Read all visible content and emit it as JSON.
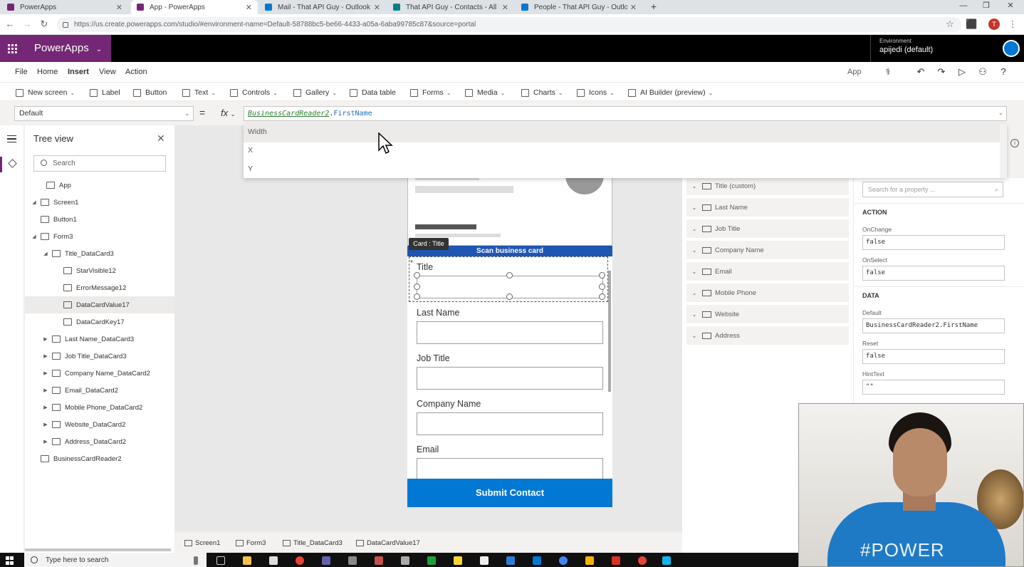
{
  "browser": {
    "tabs": [
      {
        "label": "PowerApps",
        "color": "#742774",
        "active": false
      },
      {
        "label": "App - PowerApps",
        "color": "#742774",
        "active": true
      },
      {
        "label": "Mail - That API Guy - Outlook",
        "color": "#0078d4",
        "active": false
      },
      {
        "label": "That API Guy - Contacts - All Iten",
        "color": "#038387",
        "active": false
      },
      {
        "label": "People - That API Guy - Outlook",
        "color": "#0078d4",
        "active": false
      }
    ],
    "url": "https://us.create.powerapps.com/studio/#environment-name=Default-58788bc5-be66-4433-a05a-6aba99785c87&source=portal",
    "profile_initial": "T"
  },
  "header": {
    "brand": "PowerApps",
    "env_label": "Environment",
    "env_value": "apijedi (default)"
  },
  "menu": {
    "items": [
      "File",
      "Home",
      "Insert",
      "View",
      "Action"
    ],
    "active": "Insert",
    "app_label": "App"
  },
  "ribbon": {
    "new_screen": "New screen",
    "label": "Label",
    "button": "Button",
    "text": "Text",
    "controls": "Controls",
    "gallery": "Gallery",
    "data_table": "Data table",
    "forms": "Forms",
    "media": "Media",
    "charts": "Charts",
    "icons": "Icons",
    "ai_builder": "AI Builder (preview)"
  },
  "formula": {
    "property": "Default",
    "eq": "=",
    "fx": "fx",
    "expr_part1": "BusinessCardReader2",
    "expr_dot": ".",
    "expr_part2": "FirstName",
    "suggestions": [
      "Width",
      "X",
      "Y"
    ]
  },
  "tree": {
    "title": "Tree view",
    "search_placeholder": "Search",
    "nodes": [
      {
        "label": "App",
        "indent": 0,
        "caret": ""
      },
      {
        "label": "Screen1",
        "indent": 0,
        "caret": "◢"
      },
      {
        "label": "Button1",
        "indent": 1,
        "caret": ""
      },
      {
        "label": "Form3",
        "indent": 1,
        "caret": "◢"
      },
      {
        "label": "Title_DataCard3",
        "indent": 2,
        "caret": "◢"
      },
      {
        "label": "StarVisible12",
        "indent": 3,
        "caret": ""
      },
      {
        "label": "ErrorMessage12",
        "indent": 3,
        "caret": ""
      },
      {
        "label": "DataCardValue17",
        "indent": 3,
        "caret": "",
        "selected": true
      },
      {
        "label": "DataCardKey17",
        "indent": 3,
        "caret": ""
      },
      {
        "label": "Last Name_DataCard3",
        "indent": 2,
        "caret": "▶"
      },
      {
        "label": "Job Title_DataCard3",
        "indent": 2,
        "caret": "▶"
      },
      {
        "label": "Company Name_DataCard2",
        "indent": 2,
        "caret": "▶"
      },
      {
        "label": "Email_DataCard2",
        "indent": 2,
        "caret": "▶"
      },
      {
        "label": "Mobile Phone_DataCard2",
        "indent": 2,
        "caret": "▶"
      },
      {
        "label": "Website_DataCard2",
        "indent": 2,
        "caret": "▶"
      },
      {
        "label": "Address_DataCard2",
        "indent": 2,
        "caret": "▶"
      },
      {
        "label": "BusinessCardReader2",
        "indent": 1,
        "caret": ""
      }
    ]
  },
  "canvas": {
    "card_tag": "Card : Title",
    "scan_label": "Scan business card",
    "form_labels": [
      "Title",
      "Last Name",
      "Job Title",
      "Company Name",
      "Email"
    ],
    "required_mark": "*",
    "submit_label": "Submit Contact"
  },
  "fields": [
    "Title (custom)",
    "Last Name",
    "Job Title",
    "Company Name",
    "Email",
    "Mobile Phone",
    "Website",
    "Address"
  ],
  "properties": {
    "search_placeholder": "Search for a property ...",
    "action_header": "ACTION",
    "onchange_label": "OnChange",
    "onchange_value": "false",
    "onselect_label": "OnSelect",
    "onselect_value": "false",
    "data_header": "DATA",
    "default_label": "Default",
    "default_value": "BusinessCardReader2.FirstName",
    "reset_label": "Reset",
    "reset_value": "false",
    "hinttext_label": "HintText",
    "hinttext_value": "\"\""
  },
  "breadcrumbs": [
    "Screen1",
    "Form3",
    "Title_DataCard3",
    "DataCardValue17"
  ],
  "webcam": {
    "shirt_text": "#POWER"
  },
  "taskbar": {
    "search_placeholder": "Type here to search"
  }
}
